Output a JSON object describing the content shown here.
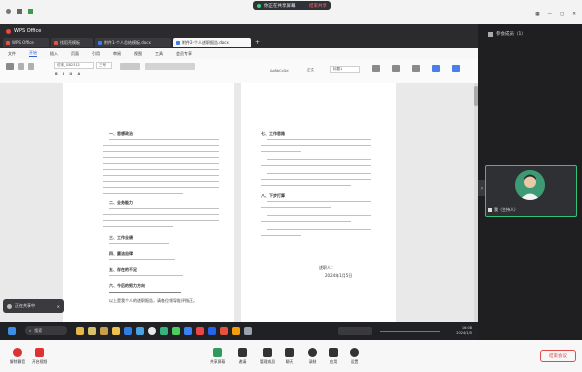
{
  "meeting": {
    "share_status": "你正在共享屏幕",
    "stop_share": "结束共享",
    "end_meeting": "结束会议",
    "controls": [
      "解除静音",
      "开启视频",
      "共享屏幕",
      "邀请",
      "管理成员",
      "聊天",
      "录制",
      "应用",
      "设置"
    ]
  },
  "browser": {
    "app_name": "WPS Office",
    "tabs": [
      "WPS Office",
      "找稻壳模板",
      "附件1-个人总结模板.docx",
      "附件2-个人述职报告.docx"
    ],
    "menus": [
      "文件",
      "开始",
      "插入",
      "页面",
      "引用",
      "审阅",
      "视图",
      "工具",
      "会员专享"
    ],
    "ribbon": {
      "style1": "正文",
      "style2": "标题1",
      "style3": "AaBbCcDd",
      "font": "仿宋_GB2312",
      "size": "三号"
    }
  },
  "document": {
    "page1": {
      "headings": [
        "一、思想政治",
        "二、业务能力",
        "三、工作业绩",
        "四、廉洁自律",
        "五、存在的不足",
        "六、今后的努力方向"
      ],
      "last_line": "以上是我个人的述职报告，请各位领导批评指正。"
    },
    "page2": {
      "headings": [
        "七、工作思路",
        "八、下步打算"
      ],
      "signature": "述职人：",
      "date": "2024年1月5日"
    }
  },
  "notification": {
    "text": "正在共享中",
    "close": "×"
  },
  "taskbar": {
    "search": "搜索",
    "time": "16:08",
    "date": "2024/1/5"
  },
  "participant": {
    "panel_title": "参会成员（1）",
    "name": "我（主持人）"
  }
}
